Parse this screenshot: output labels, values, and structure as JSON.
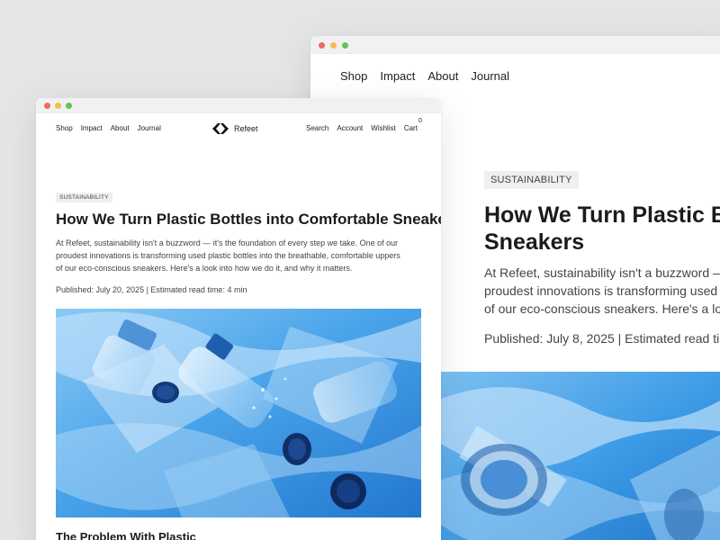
{
  "colors": {
    "background": "#e4e5e7",
    "window_bg": "#ffffff",
    "chrome_bg": "#f1f1f1",
    "close": "#ec6a5e",
    "minimize": "#f4bf4f",
    "maximize": "#61c554",
    "badge_bg": "#efefef",
    "plastic_blue": "#2f8ee0"
  },
  "back_window": {
    "nav": [
      "Shop",
      "Impact",
      "About",
      "Journal"
    ],
    "badge": "SUSTAINABILITY",
    "title_lines": [
      "How We Turn Plastic B",
      "Sneakers"
    ],
    "intro_lines": [
      "At Refeet, sustainability isn't a buzzword —",
      "proudest innovations is transforming used",
      "of our eco-conscious sneakers. Here's a loo"
    ],
    "meta": "Published: July 8, 2025 | Estimated read tim",
    "hero_image": "plastic-bottles-photo"
  },
  "front_window": {
    "nav_left": [
      "Shop",
      "Impact",
      "About",
      "Journal"
    ],
    "logo_icon": "refeet-logo-icon",
    "brand": "Refeet",
    "nav_right": [
      "Search",
      "Account",
      "Wishlist",
      "Cart"
    ],
    "cart_count": "0",
    "badge": "SUSTAINABILITY",
    "title": "How We Turn Plastic Bottles into Comfortable Sneakers",
    "intro_lines": [
      "At Refeet, sustainability isn't a buzzword — it's the foundation of every step we take. One of our",
      "proudest innovations is transforming used plastic bottles into the breathable, comfortable uppers",
      "of our eco-conscious sneakers. Here's a look into how we do it, and why it matters."
    ],
    "meta": "Published: July 20, 2025 | Estimated read time: 4 min",
    "hero_image": "plastic-bottles-photo",
    "section_heading": "The Problem With Plastic"
  }
}
